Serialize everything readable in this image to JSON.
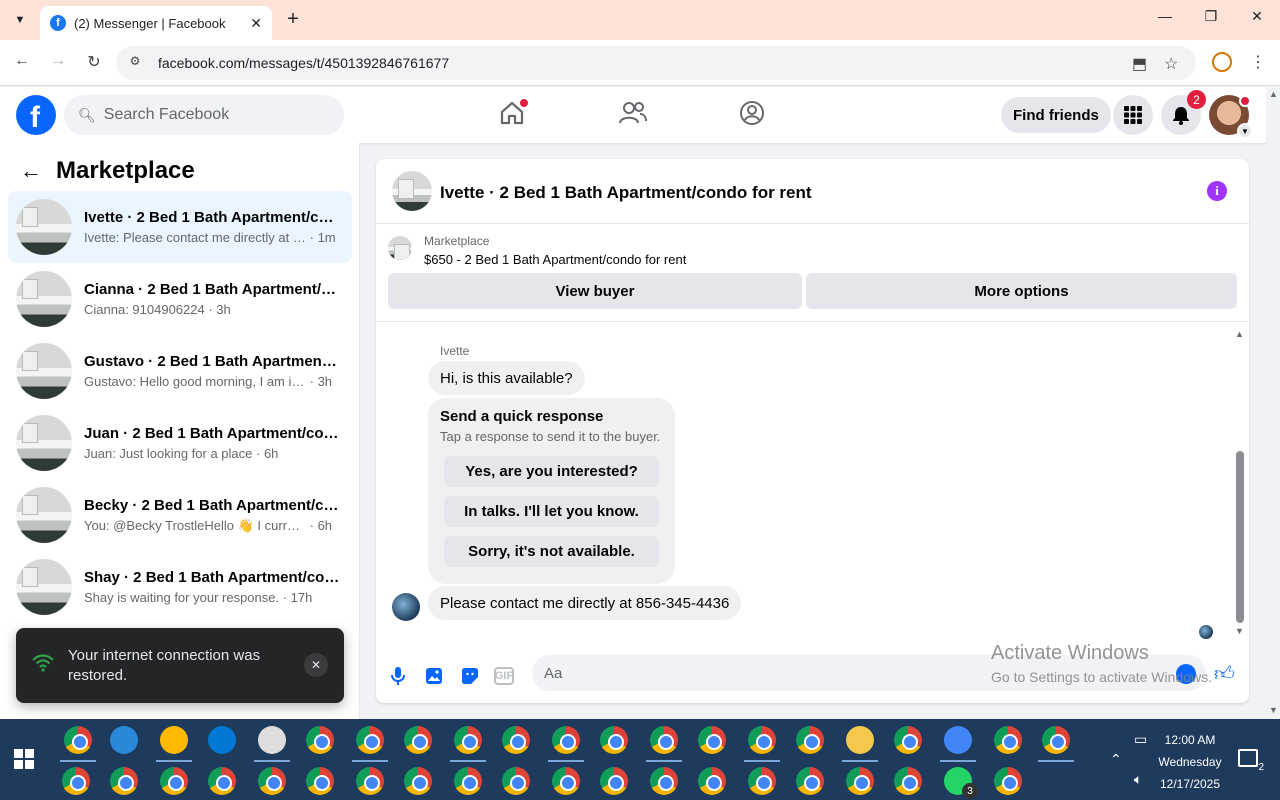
{
  "browser": {
    "tab_title": "(2) Messenger | Facebook",
    "url": "facebook.com/messages/t/4501392846761677"
  },
  "header": {
    "search_placeholder": "Search Facebook",
    "find_friends": "Find friends",
    "notification_count": "2",
    "icons": [
      "home-icon",
      "friends-icon",
      "groups-icon",
      "grid-menu-icon",
      "bell-icon"
    ]
  },
  "sidebar": {
    "title": "Marketplace",
    "conversations": [
      {
        "name": "Ivette · 2 Bed 1 Bath Apartment/condo for rent",
        "preview": "Ivette: Please contact me directly at 856-345-4436",
        "time": "1m",
        "active": true
      },
      {
        "name": "Cianna · 2 Bed 1 Bath Apartment/condo for rent",
        "preview": "Cianna: 9104906224",
        "time": "3h"
      },
      {
        "name": "Gustavo · 2 Bed 1 Bath Apartment/condo for rent",
        "preview": "Gustavo: Hello good morning, I am interested",
        "time": "3h"
      },
      {
        "name": "Juan · 2 Bed 1 Bath Apartment/condo for rent",
        "preview": "Juan: Just looking for a place",
        "time": "6h"
      },
      {
        "name": "Becky · 2 Bed 1 Bath Apartment/condo for rent",
        "preview": "You: @Becky TrostleHello 👋 I currently",
        "time": "6h"
      },
      {
        "name": "Shay · 2 Bed 1 Bath Apartment/condo for rent",
        "preview": "Shay is waiting for your response.",
        "time": "17h"
      }
    ]
  },
  "toast": {
    "message": "Your internet connection was restored."
  },
  "chat": {
    "title": "Ivette · 2 Bed 1 Bath Apartment/condo for rent",
    "listing_category": "Marketplace",
    "listing_price": "$650 - 2 Bed 1 Bath Apartment/condo for rent",
    "view_buyer": "View buyer",
    "more_options": "More options",
    "sender": "Ivette",
    "message_1": "Hi, is this available?",
    "quick_response_title": "Send a quick response",
    "quick_response_subtitle": "Tap a response to send it to the buyer.",
    "quick_responses": [
      "Yes, are you interested?",
      "In talks. I'll let you know.",
      "Sorry, it's not available."
    ],
    "message_2": "Please contact me directly at 856-345-4436",
    "composer_placeholder": "Aa"
  },
  "watermark": {
    "line1": "Activate Windows",
    "line2": "Go to Settings to activate Windows."
  },
  "taskbar": {
    "time": "12:00 AM",
    "day": "Wednesday",
    "date": "12/17/2025",
    "notification_count": "2",
    "whatsapp_badge": "3"
  }
}
